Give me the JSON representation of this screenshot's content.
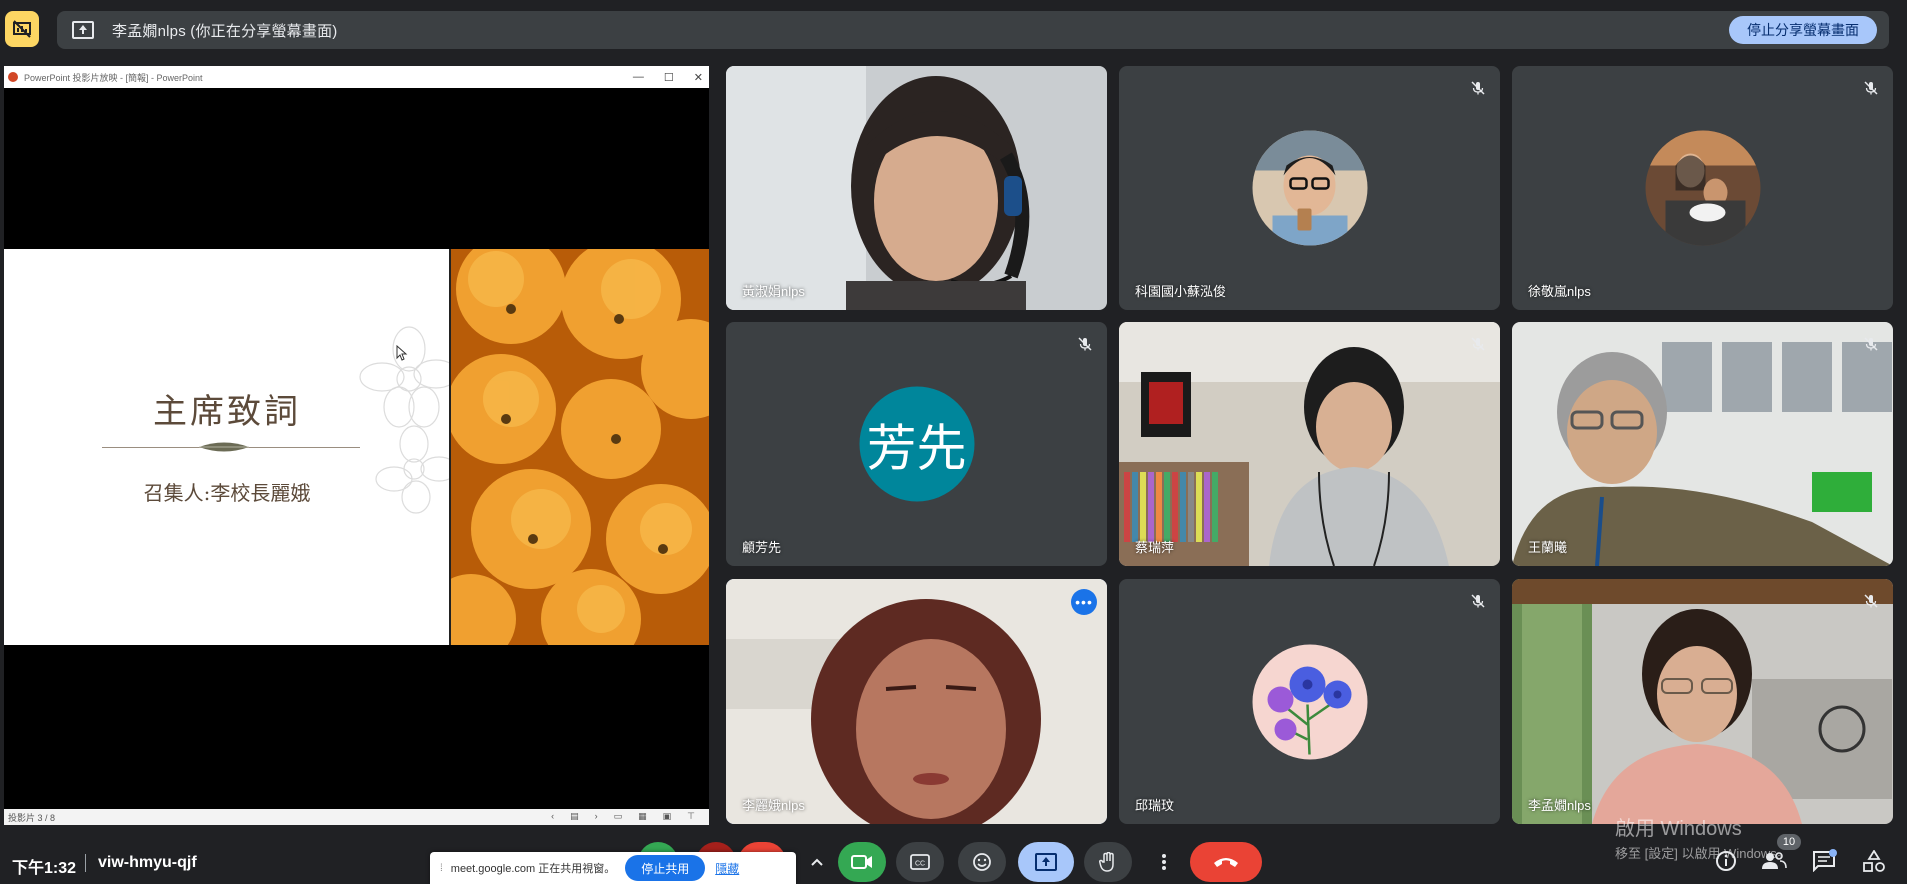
{
  "topbar": {
    "presenter_title": "李孟嫺nlps (你正在分享螢幕畫面)",
    "stop_sharing_label": "停止分享螢幕畫面"
  },
  "ppt_window": {
    "title": "PowerPoint 投影片放映 - [簡報] - PowerPoint",
    "slide_title": "主席致詞",
    "slide_subtitle": "召集人:李校長麗娥",
    "status": "投影片 3 / 8"
  },
  "participants": [
    {
      "name": "黃淑娟nlps",
      "muted": false,
      "type": "video"
    },
    {
      "name": "科園國小蘇泓俊",
      "muted": true,
      "type": "photo"
    },
    {
      "name": "徐敬嵐nlps",
      "muted": true,
      "type": "photo"
    },
    {
      "name": "顧芳先",
      "muted": true,
      "type": "initials",
      "initials": "芳先",
      "color": "#00869b"
    },
    {
      "name": "蔡瑞萍",
      "muted": true,
      "type": "video"
    },
    {
      "name": "王蘭曦",
      "muted": true,
      "type": "video"
    },
    {
      "name": "李麗娥nlps",
      "muted": false,
      "type": "video",
      "active": true
    },
    {
      "name": "邱瑞玟",
      "muted": true,
      "type": "photo"
    },
    {
      "name": "李孟嫺nlps",
      "muted": true,
      "type": "video"
    }
  ],
  "bottombar": {
    "time": "下午1:32",
    "meeting_code": "viw-hmyu-qjf",
    "share_notice_text": "meet.google.com 正在共用視窗。",
    "share_notice_stop": "停止共用",
    "share_notice_hide": "隱藏",
    "people_count": "10"
  },
  "watermark": {
    "line1": "啟用 Windows",
    "line2": "移至 [設定] 以啟用 Windows。"
  },
  "colors": {
    "background": "#202124",
    "surface": "#3c4043",
    "accent": "#a8c7fa",
    "hangup": "#ea4335",
    "camera_on": "#34a853",
    "warning": "#fdd663"
  }
}
